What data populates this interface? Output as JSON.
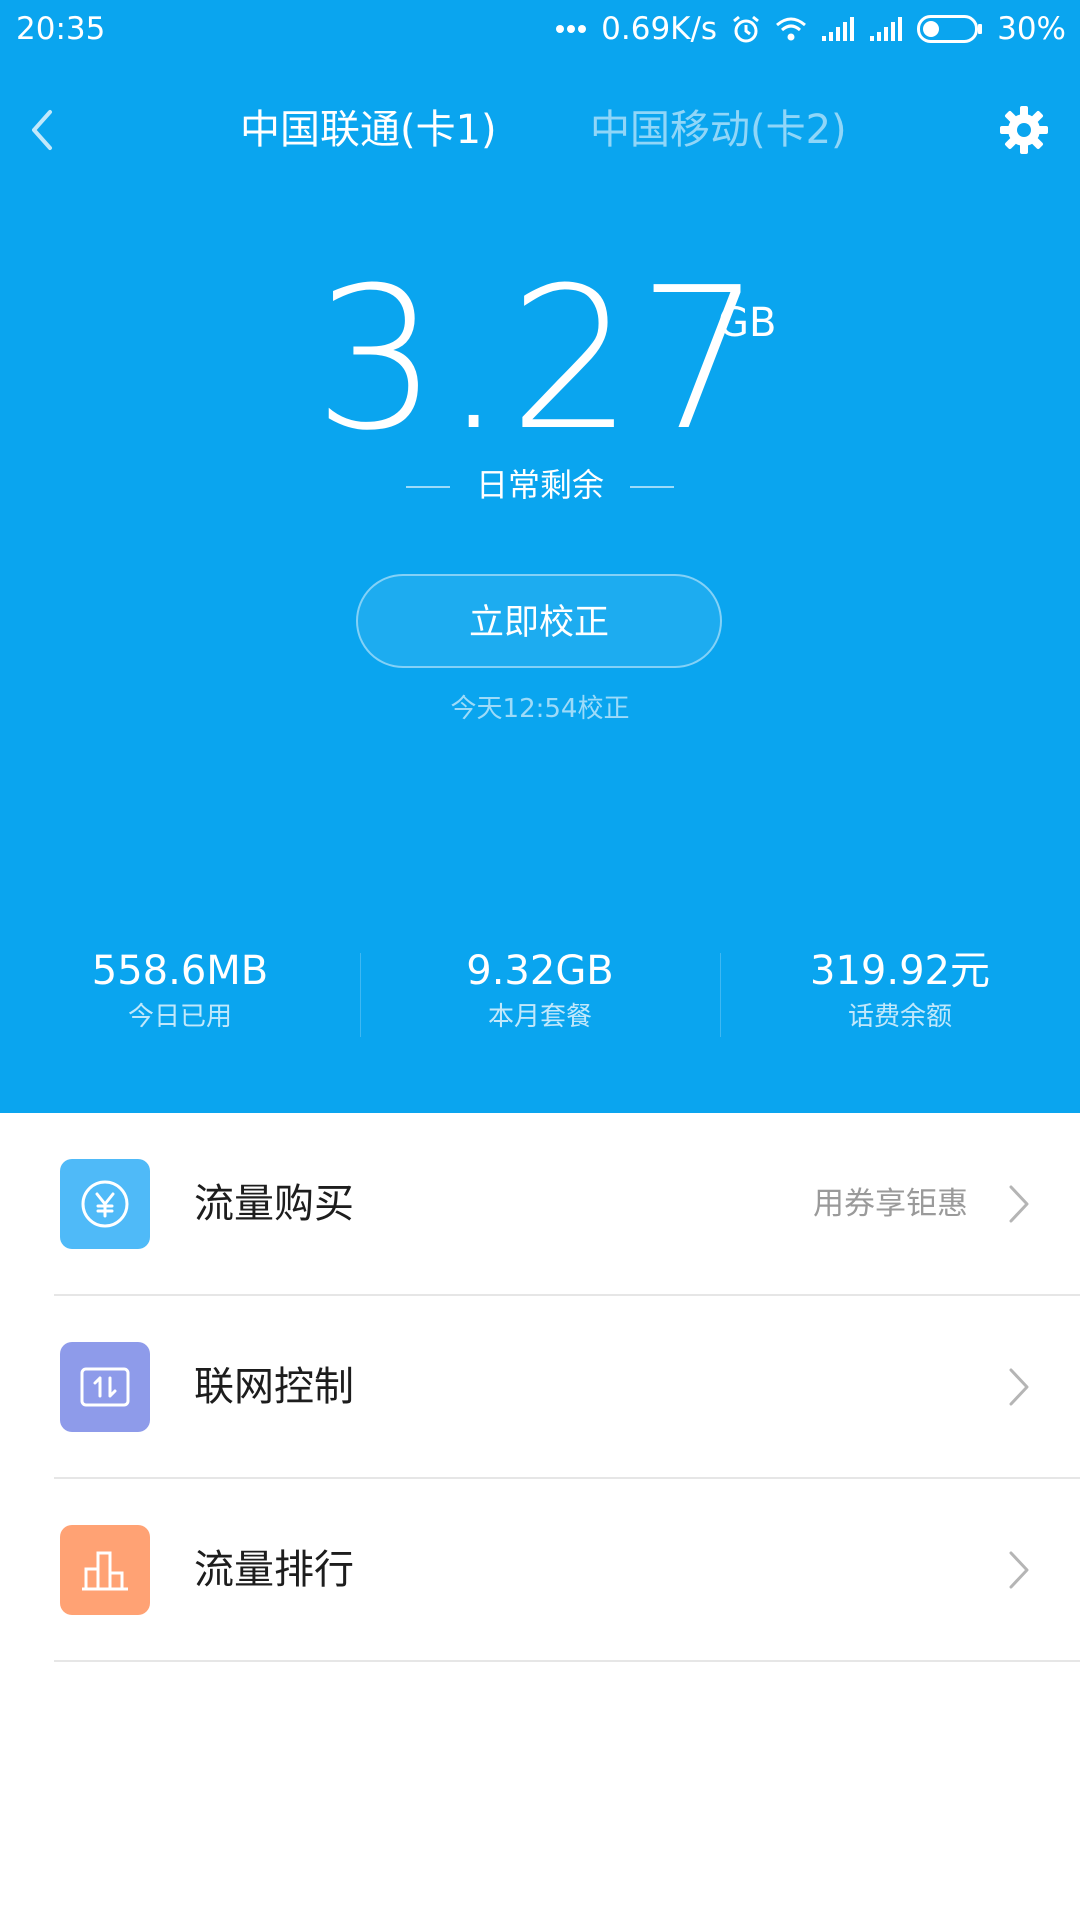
{
  "status_bar": {
    "time": "20:35",
    "network_speed": "0.69K/s",
    "battery_percent": "30%",
    "battery_level": 0.3,
    "icons": [
      "more-dots-icon",
      "alarm-icon",
      "wifi-icon",
      "signal-icon",
      "signal-icon",
      "battery-icon"
    ]
  },
  "nav": {
    "tab_sim1": "中国联通(卡1)",
    "tab_sim2": "中国移动(卡2)",
    "back_icon": "chevron-left-icon",
    "settings_icon": "gear-icon"
  },
  "summary": {
    "remaining_value": "3.27",
    "remaining_unit": "GB",
    "remaining_label": "日常剩余",
    "calibrate_button": "立即校正",
    "calibrated_at": "今天12:54校正"
  },
  "stats": [
    {
      "value": "558.6MB",
      "label": "今日已用"
    },
    {
      "value": "9.32GB",
      "label": "本月套餐"
    },
    {
      "value": "319.92元",
      "label": "话费余额"
    }
  ],
  "menu": [
    {
      "label": "流量购买",
      "hint": "用券享钜惠",
      "icon": "yuan-coin-icon",
      "color": "#4fbaf8"
    },
    {
      "label": "联网控制",
      "hint": "",
      "icon": "network-updown-icon",
      "color": "#8e9bea"
    },
    {
      "label": "流量排行",
      "hint": "",
      "icon": "bar-chart-icon",
      "color": "#ffa274"
    }
  ],
  "colors": {
    "header_bg": "#0aa5ef",
    "page_bg": "#ffffff"
  }
}
